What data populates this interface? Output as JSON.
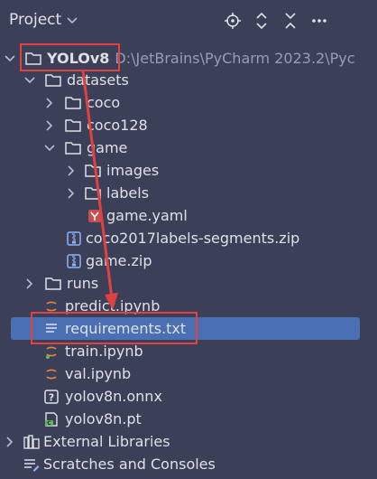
{
  "header": {
    "title": "Project",
    "title_chevron": "chevron-down-icon"
  },
  "toolbar_icons": [
    "locate-icon",
    "expand-collapse-icon",
    "collapse-all-icon",
    "more-options-icon"
  ],
  "tree": [
    {
      "label": "YOLOv8",
      "path": "D:\\JetBrains\\PyCharm 2023.2\\Pyc",
      "icon": "folder-icon",
      "expanded": true
    },
    {
      "label": "datasets",
      "icon": "folder-icon",
      "expanded": true
    },
    {
      "label": "coco",
      "icon": "folder-icon",
      "expanded": false
    },
    {
      "label": "coco128",
      "icon": "folder-icon",
      "expanded": false
    },
    {
      "label": "game",
      "icon": "folder-icon",
      "expanded": true
    },
    {
      "label": "images",
      "icon": "folder-icon",
      "expanded": false
    },
    {
      "label": "labels",
      "icon": "folder-icon",
      "expanded": false
    },
    {
      "label": "game.yaml",
      "icon": "yaml-file-icon"
    },
    {
      "label": "coco2017labels-segments.zip",
      "icon": "zip-file-icon"
    },
    {
      "label": "game.zip",
      "icon": "zip-file-icon"
    },
    {
      "label": "runs",
      "icon": "folder-icon",
      "expanded": false
    },
    {
      "label": "predict.ipynb",
      "icon": "notebook-icon"
    },
    {
      "label": "requirements.txt",
      "icon": "text-file-icon",
      "selected": true
    },
    {
      "label": "train.ipynb",
      "icon": "notebook-icon"
    },
    {
      "label": "val.ipynb",
      "icon": "notebook-icon"
    },
    {
      "label": "yolov8n.onnx",
      "icon": "unknown-file-icon"
    },
    {
      "label": "yolov8n.pt",
      "icon": "pt-file-icon"
    },
    {
      "label": "External Libraries",
      "icon": "library-icon",
      "expanded": false
    },
    {
      "label": "Scratches and Consoles",
      "icon": "scratches-icon"
    }
  ],
  "colors": {
    "background": "#3c3f58",
    "selection": "#4a6fb3",
    "annotation": "#e24141"
  }
}
